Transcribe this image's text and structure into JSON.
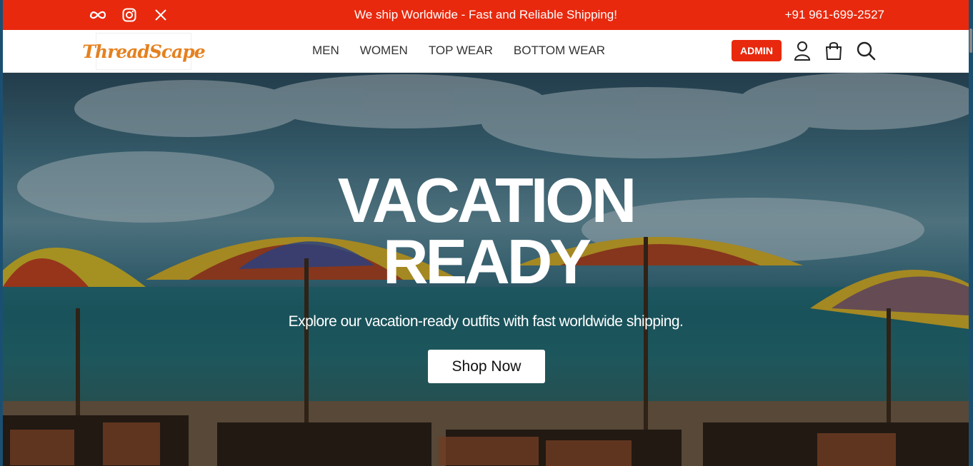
{
  "topbar": {
    "message": "We ship Worldwide - Fast and Reliable Shipping!",
    "phone": "+91 961-699-2527",
    "social_icons": [
      "meta-icon",
      "instagram-icon",
      "x-twitter-icon"
    ]
  },
  "header": {
    "logo_text": "ThreadScape",
    "nav": [
      "MEN",
      "WOMEN",
      "TOP WEAR",
      "BOTTOM WEAR"
    ],
    "admin_label": "ADMIN",
    "icons": [
      "user-icon",
      "shopping-bag-icon",
      "search-icon"
    ]
  },
  "hero": {
    "title_line1": "VACATION",
    "title_line2": "READY",
    "subtitle": "Explore our vacation-ready outfits with fast worldwide shipping.",
    "cta_label": "Shop Now"
  },
  "colors": {
    "accent": "#e8290e",
    "logo": "#e4811f"
  }
}
